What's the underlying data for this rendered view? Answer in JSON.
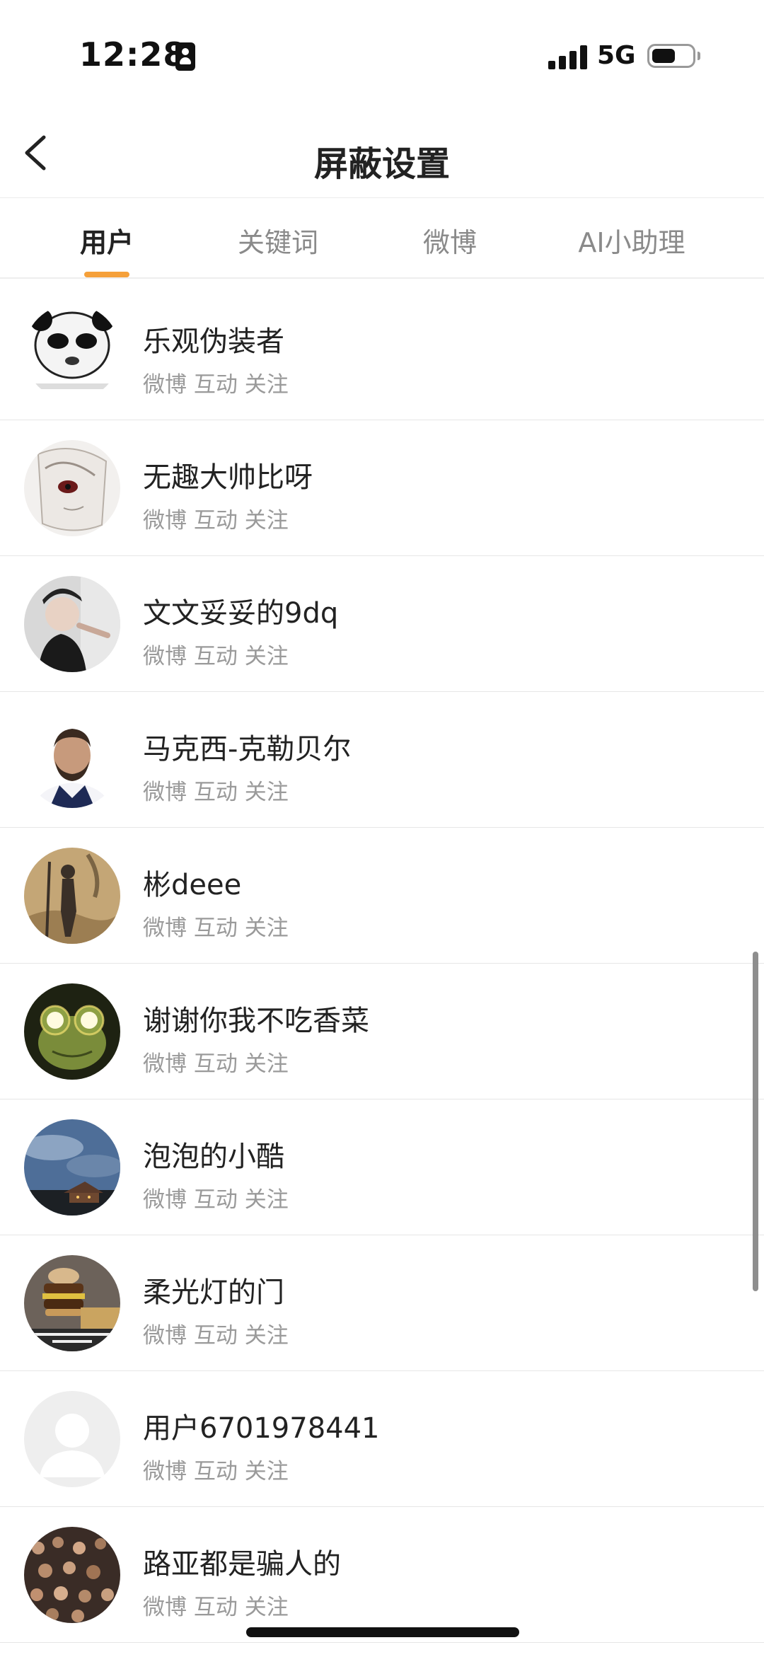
{
  "status_bar": {
    "time": "12:28",
    "network": "5G",
    "battery_level": 0.6,
    "signal_bars": 4
  },
  "nav": {
    "title": "屏蔽设置"
  },
  "tabs": [
    {
      "label": "用户",
      "active": true
    },
    {
      "label": "关键词",
      "active": false
    },
    {
      "label": "微博",
      "active": false
    },
    {
      "label": "AI小助理",
      "active": false
    }
  ],
  "accent_color": "#f5a03a",
  "users": [
    {
      "name": "乐观伪装者",
      "sub": "微博 互动 关注",
      "avatar": "panda-meme-avatar"
    },
    {
      "name": "无趣大帅比呀",
      "sub": "微博 互动 关注",
      "avatar": "sketch-face-avatar"
    },
    {
      "name": "文文妥妥的9dq",
      "sub": "微博 互动 关注",
      "avatar": "person-photo-avatar"
    },
    {
      "name": "马克西-克勒贝尔",
      "sub": "微博 互动 关注",
      "avatar": "player-portrait-avatar"
    },
    {
      "name": "彬deee",
      "sub": "微博 互动 关注",
      "avatar": "shadow-photo-avatar"
    },
    {
      "name": "谢谢你我不吃香菜",
      "sub": "微博 互动 关注",
      "avatar": "frog-avatar"
    },
    {
      "name": "泡泡的小酷",
      "sub": "微博 互动 关注",
      "avatar": "sky-photo-avatar"
    },
    {
      "name": "柔光灯的门",
      "sub": "微博 互动 关注",
      "avatar": "burger-meme-avatar"
    },
    {
      "name": "用户6701978441",
      "sub": "微博 互动 关注",
      "avatar": "default-user-avatar"
    },
    {
      "name": "路亚都是骗人的",
      "sub": "微博 互动 关注",
      "avatar": "crowd-photo-avatar"
    }
  ]
}
